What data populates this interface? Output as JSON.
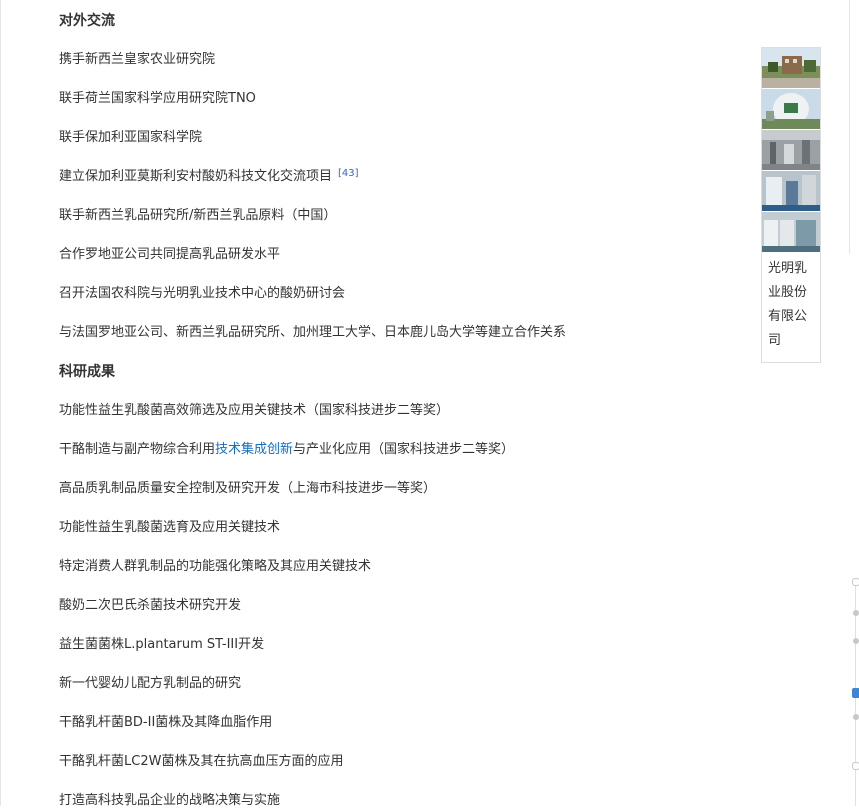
{
  "sections": [
    {
      "heading": "对外交流",
      "items": [
        {
          "text": "携手新西兰皇家农业研究院"
        },
        {
          "text": "联手荷兰国家科学应用研究院TNO"
        },
        {
          "text": "联手保加利亚国家科学院"
        },
        {
          "text": "建立保加利亚莫斯利安村酸奶科技文化交流项目",
          "ref": "[43]"
        },
        {
          "text": "联手新西兰乳品研究所/新西兰乳品原料（中国）"
        },
        {
          "text": "合作罗地亚公司共同提高乳品研发水平"
        },
        {
          "text": "召开法国农科院与光明乳业技术中心的酸奶研讨会"
        },
        {
          "text": "与法国罗地亚公司、新西兰乳品研究所、加州理工大学、日本鹿儿岛大学等建立合作关系"
        }
      ]
    },
    {
      "heading": "科研成果",
      "items": [
        {
          "text": "功能性益生乳酸菌高效筛选及应用关键技术（国家科技进步二等奖）"
        },
        {
          "pre": "干酪制造与副产物综合利用",
          "link": "技术集成创新",
          "post": "与产业化应用（国家科技进步二等奖）"
        },
        {
          "text": "高品质乳制品质量安全控制及研究开发（上海市科技进步一等奖）"
        },
        {
          "text": "功能性益生乳酸菌选育及应用关键技术"
        },
        {
          "text": "特定消费人群乳制品的功能强化策略及其应用关键技术"
        },
        {
          "text": "酸奶二次巴氏杀菌技术研究开发"
        },
        {
          "text": "益生菌菌株L.plantarum ST-III开发"
        },
        {
          "text": "新一代婴幼儿配方乳制品的研究"
        },
        {
          "text": "干酪乳杆菌BD-II菌株及其降血脂作用"
        },
        {
          "text": "干酪乳杆菌LC2W菌株及其在抗高血压方面的应用"
        },
        {
          "text": "打造高科技乳品企业的战略决策与实施"
        }
      ]
    }
  ],
  "album": {
    "caption": "光明乳业股份有限公司",
    "photos": [
      "building-photo",
      "factory-exterior-photo",
      "lab-interior-photo",
      "lab-equipment-photo",
      "production-line-photo"
    ]
  },
  "colors": {
    "link": "#136ec2",
    "ref": "#3366cc",
    "text": "#333333",
    "active_dot": "#3d86d6"
  }
}
